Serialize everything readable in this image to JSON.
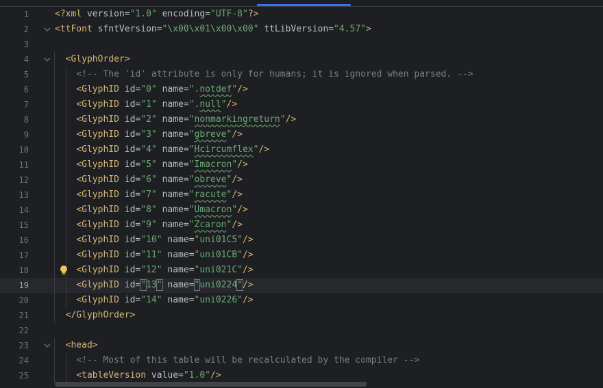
{
  "editor": {
    "lines": [
      {
        "n": "1",
        "text": "<?xml version=\"1.0\" encoding=\"UTF-8\"?>"
      },
      {
        "n": "2",
        "text": "<ttFont sfntVersion=\"\\x00\\x01\\x00\\x00\" ttLibVersion=\"4.57\">"
      },
      {
        "n": "3",
        "text": ""
      },
      {
        "n": "4",
        "text": "  <GlyphOrder>"
      },
      {
        "n": "5",
        "text": "    <!-- The 'id' attribute is only for humans; it is ignored when parsed. -->"
      },
      {
        "n": "6",
        "text": "    <GlyphID id=\"0\" name=\".notdef\"/>"
      },
      {
        "n": "7",
        "text": "    <GlyphID id=\"1\" name=\".null\"/>"
      },
      {
        "n": "8",
        "text": "    <GlyphID id=\"2\" name=\"nonmarkingreturn\"/>"
      },
      {
        "n": "9",
        "text": "    <GlyphID id=\"3\" name=\"gbreve\"/>"
      },
      {
        "n": "10",
        "text": "    <GlyphID id=\"4\" name=\"Hcircumflex\"/>"
      },
      {
        "n": "11",
        "text": "    <GlyphID id=\"5\" name=\"Imacron\"/>"
      },
      {
        "n": "12",
        "text": "    <GlyphID id=\"6\" name=\"obreve\"/>"
      },
      {
        "n": "13",
        "text": "    <GlyphID id=\"7\" name=\"racute\"/>"
      },
      {
        "n": "14",
        "text": "    <GlyphID id=\"8\" name=\"Umacron\"/>"
      },
      {
        "n": "15",
        "text": "    <GlyphID id=\"9\" name=\"Zcaron\"/>"
      },
      {
        "n": "16",
        "text": "    <GlyphID id=\"10\" name=\"uni01C5\"/>"
      },
      {
        "n": "17",
        "text": "    <GlyphID id=\"11\" name=\"uni01CB\"/>"
      },
      {
        "n": "18",
        "text": "    <GlyphID id=\"12\" name=\"uni021C\"/>"
      },
      {
        "n": "19",
        "text": "    <GlyphID id=\"13\" name=\"uni0224\"/>"
      },
      {
        "n": "20",
        "text": "    <GlyphID id=\"14\" name=\"uni0226\"/>"
      },
      {
        "n": "21",
        "text": "  </GlyphOrder>"
      },
      {
        "n": "22",
        "text": ""
      },
      {
        "n": "23",
        "text": "  <head>"
      },
      {
        "n": "24",
        "text": "    <!-- Most of this table will be recalculated by the compiler -->"
      },
      {
        "n": "25",
        "text": "    <tableVersion value=\"1.0\"/>"
      }
    ],
    "current_line": "19",
    "folded_lines": [
      "2",
      "4",
      "23"
    ],
    "spellcheck_words": [
      "notdef",
      "null",
      "nonmarkingreturn",
      "gbreve",
      "Hcircumflex",
      "Imacron",
      "obreve",
      "racute",
      "Umacron",
      "Zcaron"
    ],
    "bulb_line": "18"
  },
  "icons": {
    "fold": "chevron-down-icon",
    "intention": "lightbulb-icon"
  },
  "colors": {
    "background": "#1e1f22",
    "tag": "#d5b778",
    "attribute": "#bcbec4",
    "value": "#6aab73",
    "comment": "#7a7e85",
    "line_number": "#6f737a",
    "accent": "#3574f0"
  }
}
